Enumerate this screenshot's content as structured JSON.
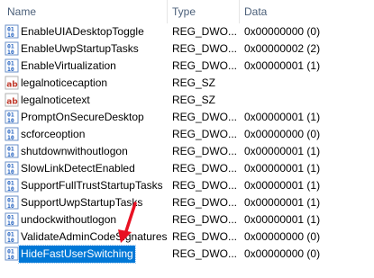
{
  "header": {
    "name_label": "Name",
    "type_label": "Type",
    "data_label": "Data"
  },
  "rows": [
    {
      "name": "EnableUIADesktopToggle",
      "type": "REG_DWO...",
      "data": "0x00000000 (0)",
      "icon": "reg-dword-icon"
    },
    {
      "name": "EnableUwpStartupTasks",
      "type": "REG_DWO...",
      "data": "0x00000002 (2)",
      "icon": "reg-dword-icon"
    },
    {
      "name": "EnableVirtualization",
      "type": "REG_DWO...",
      "data": "0x00000001 (1)",
      "icon": "reg-dword-icon"
    },
    {
      "name": "legalnoticecaption",
      "type": "REG_SZ",
      "data": "",
      "icon": "reg-string-icon"
    },
    {
      "name": "legalnoticetext",
      "type": "REG_SZ",
      "data": "",
      "icon": "reg-string-icon"
    },
    {
      "name": "PromptOnSecureDesktop",
      "type": "REG_DWO...",
      "data": "0x00000001 (1)",
      "icon": "reg-dword-icon"
    },
    {
      "name": "scforceoption",
      "type": "REG_DWO...",
      "data": "0x00000000 (0)",
      "icon": "reg-dword-icon"
    },
    {
      "name": "shutdownwithoutlogon",
      "type": "REG_DWO...",
      "data": "0x00000001 (1)",
      "icon": "reg-dword-icon"
    },
    {
      "name": "SlowLinkDetectEnabled",
      "type": "REG_DWO...",
      "data": "0x00000001 (1)",
      "icon": "reg-dword-icon"
    },
    {
      "name": "SupportFullTrustStartupTasks",
      "type": "REG_DWO...",
      "data": "0x00000001 (1)",
      "icon": "reg-dword-icon"
    },
    {
      "name": "SupportUwpStartupTasks",
      "type": "REG_DWO...",
      "data": "0x00000001 (1)",
      "icon": "reg-dword-icon"
    },
    {
      "name": "undockwithoutlogon",
      "type": "REG_DWO...",
      "data": "0x00000001 (1)",
      "icon": "reg-dword-icon"
    },
    {
      "name": "ValidateAdminCodeSignatures",
      "type": "REG_DWO...",
      "data": "0x00000000 (0)",
      "icon": "reg-dword-icon"
    },
    {
      "name": "HideFastUserSwitching",
      "type": "REG_DWO...",
      "data": "0x00000000 (0)",
      "icon": "reg-dword-icon",
      "selected": true
    }
  ],
  "colors": {
    "selection": "#0078d7",
    "header_text": "#4c607a",
    "annotation_arrow": "#e81123",
    "dword_icon_blue": "#1f5fbf",
    "string_icon_red": "#c0392b"
  },
  "annotation": {
    "icon": "red-arrow-icon",
    "points_to": "HideFastUserSwitching"
  }
}
